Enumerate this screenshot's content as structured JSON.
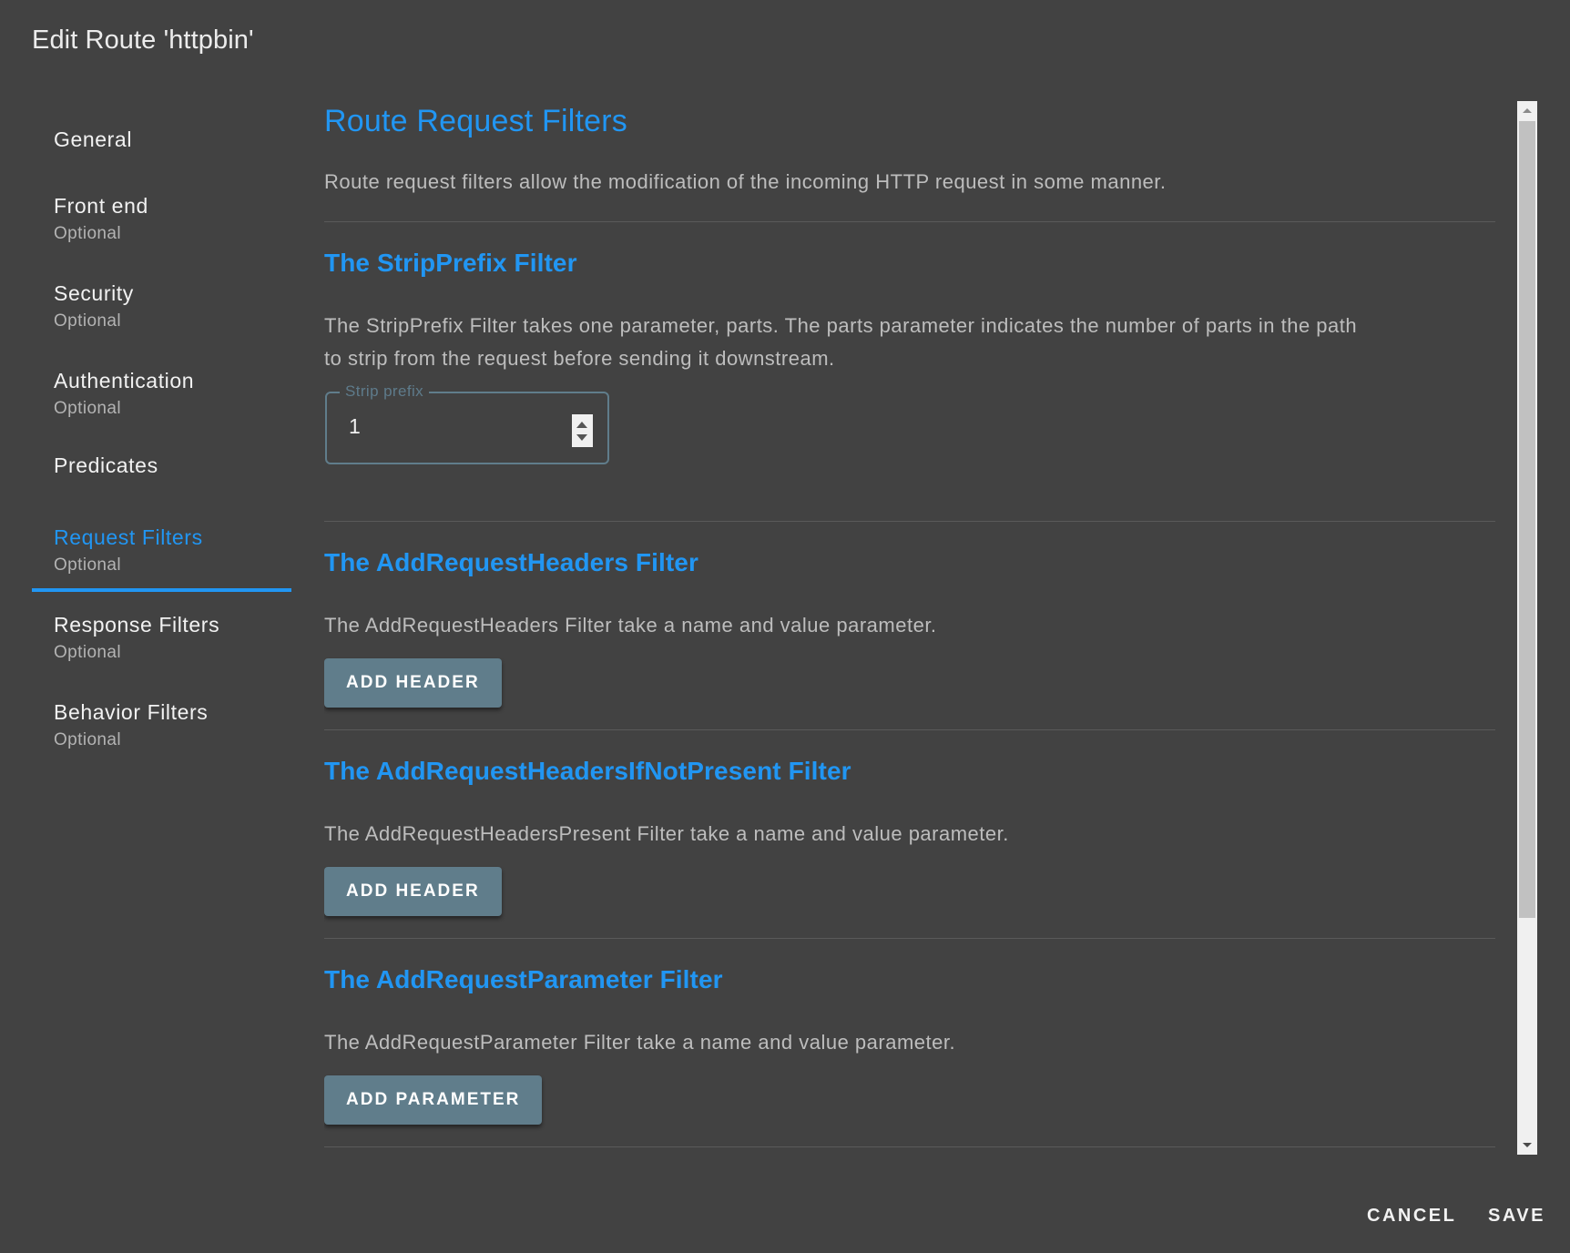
{
  "dialog": {
    "title": "Edit Route 'httpbin'"
  },
  "sidebar": {
    "items": [
      {
        "label": "General",
        "sub": null
      },
      {
        "label": "Front end",
        "sub": "Optional"
      },
      {
        "label": "Security",
        "sub": "Optional"
      },
      {
        "label": "Authentication",
        "sub": "Optional"
      },
      {
        "label": "Predicates",
        "sub": null
      },
      {
        "label": "Request Filters",
        "sub": "Optional",
        "active": true
      },
      {
        "label": "Response Filters",
        "sub": "Optional"
      },
      {
        "label": "Behavior Filters",
        "sub": "Optional"
      }
    ]
  },
  "content": {
    "heading": "Route Request Filters",
    "intro": "Route request filters allow the modification of the incoming HTTP request in some manner.",
    "sections": [
      {
        "title": "The StripPrefix Filter",
        "description_line1": "The StripPrefix Filter takes one parameter, parts. The parts parameter indicates the number of parts in the path",
        "description_line2": "to strip from the request before sending it downstream.",
        "field": {
          "label": "Strip prefix",
          "value": "1"
        }
      },
      {
        "title": "The AddRequestHeaders Filter",
        "description": "The AddRequestHeaders Filter take a name and value parameter.",
        "button": "ADD HEADER"
      },
      {
        "title": "The AddRequestHeadersIfNotPresent Filter",
        "description": "The AddRequestHeadersPresent Filter take a name and value parameter.",
        "button": "ADD HEADER"
      },
      {
        "title": "The AddRequestParameter Filter",
        "description": "The AddRequestParameter Filter take a name and value parameter.",
        "button": "ADD PARAMETER"
      }
    ]
  },
  "actions": {
    "cancel": "CANCEL",
    "save": "SAVE"
  },
  "colors": {
    "accent": "#2196f3",
    "button": "#607d8b",
    "background": "#424242"
  }
}
